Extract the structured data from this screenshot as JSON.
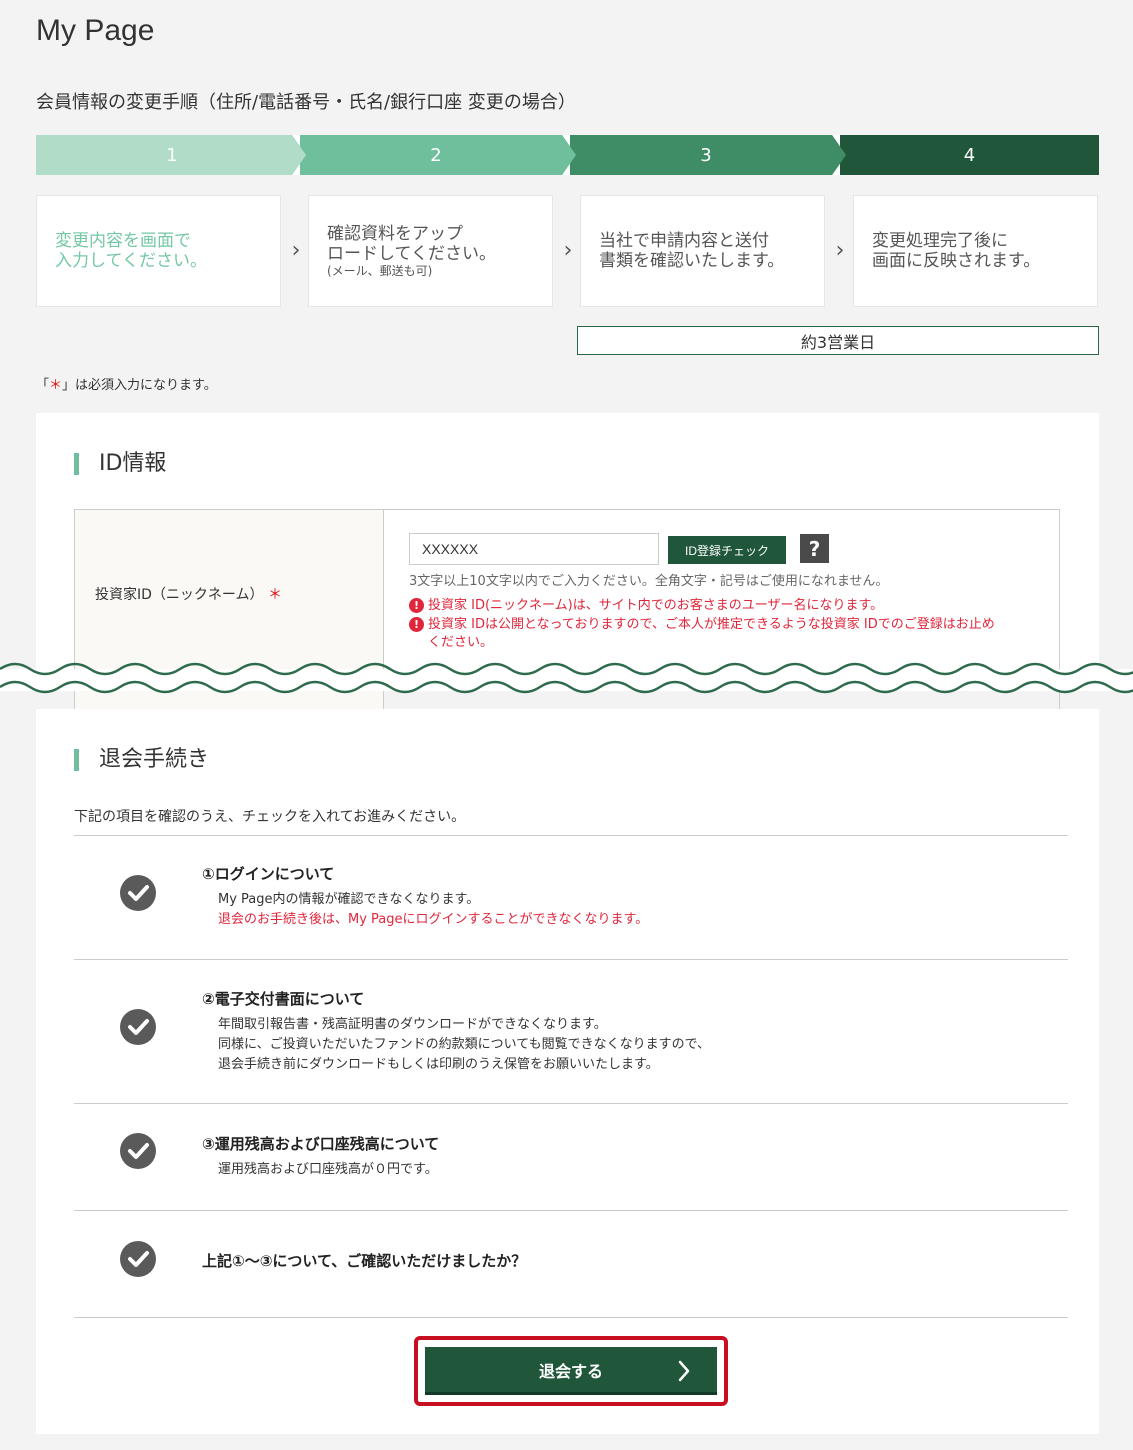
{
  "header": {
    "title": "My Page",
    "subtitle": "会員情報の変更手順（住所/電話番号・氏名/銀行口座 変更の場合）"
  },
  "stepper": {
    "steps": [
      "1",
      "2",
      "3",
      "4"
    ],
    "colors": [
      "#b0dcc8",
      "#6fbe9c",
      "#3e8d66",
      "#20573b"
    ]
  },
  "step_boxes": [
    {
      "line1": "変更内容を画面で",
      "line2": "入力してください。",
      "note": ""
    },
    {
      "line1": "確認資料をアップ",
      "line2": "ロードしてください。",
      "note": "(メール、郵送も可)"
    },
    {
      "line1": "当社で申請内容と送付",
      "line2": "書類を確認いたします。",
      "note": ""
    },
    {
      "line1": "変更処理完了後に",
      "line2": "画面に反映されます。",
      "note": ""
    }
  ],
  "days_label": "約3営業日",
  "required_note": {
    "prefix": "「",
    "star": "＊",
    "suffix": "」は必須入力になります。"
  },
  "id_section": {
    "title": "ID情報",
    "field_label": "投資家ID（ニックネーム）",
    "required_mark": "＊",
    "input_value": "XXXXXX",
    "check_button": "ID登録チェック",
    "help_icon": "?",
    "hint": "3文字以上10文字以内でご入力ください。全角文字・記号はご使用になれません。",
    "warnings": [
      "投資家 ID(ニックネーム)は、サイト内でのお客さまのユーザー名になります。",
      "投資家 IDは公開となっておりますので、ご本人が推定できるような投資家 IDでのご登録はお止め",
      "ください。"
    ],
    "warning_icon": "!"
  },
  "withdraw_section": {
    "title": "退会手続き",
    "intro": "下記の項目を確認のうえ、チェックを入れてお進みください。",
    "items": [
      {
        "title": "①ログインについて",
        "lines": [
          "My Page内の情報が確認できなくなります。"
        ],
        "red_line": "退会のお手続き後は、My Pageにログインすることができなくなります。"
      },
      {
        "title": "②電子交付書面について",
        "lines": [
          "年間取引報告書・残高証明書のダウンロードができなくなります。",
          "同様に、ご投資いただいたファンドの約款類についても閲覧できなくなりますので、",
          "退会手続き前にダウンロードもしくは印刷のうえ保管をお願いいたします。"
        ]
      },
      {
        "title": "③運用残高および口座残高について",
        "lines": [
          "運用残高および口座残高が０円です。"
        ]
      },
      {
        "title": "上記①～③について、ご確認いただけましたか？",
        "lines": []
      }
    ],
    "submit_label": "退会する"
  },
  "colors": {
    "brand_green": "#20573b",
    "accent_green": "#6fbe9c",
    "warning_red": "#e0263b",
    "highlight_red": "#c80f22"
  }
}
